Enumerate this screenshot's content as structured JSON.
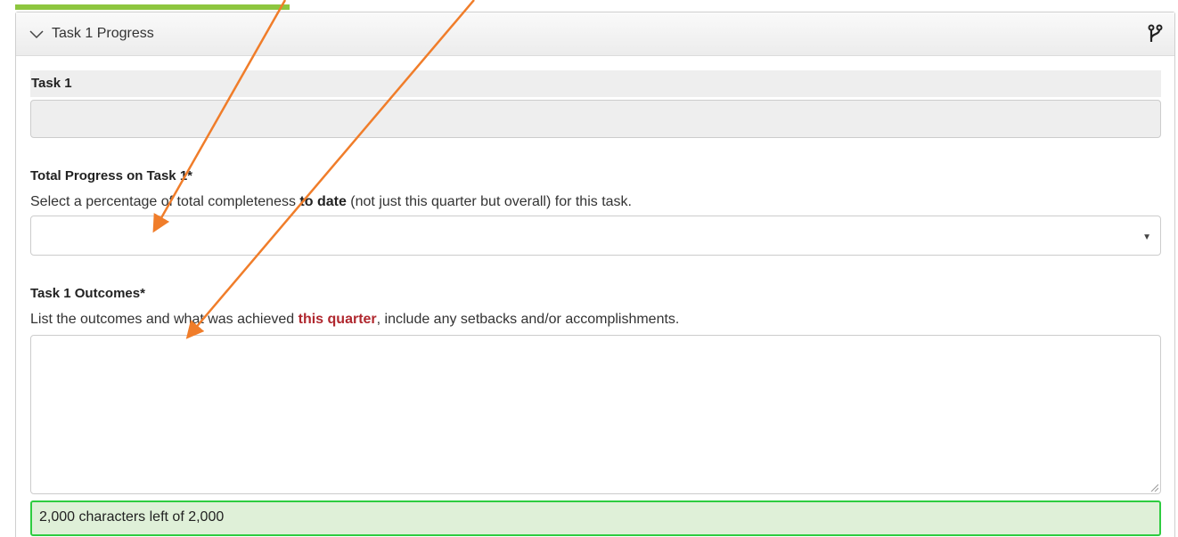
{
  "panel": {
    "title": "Task 1 Progress"
  },
  "task": {
    "section_label": "Task 1"
  },
  "progress": {
    "label": "Total Progress on Task 1*",
    "help_prefix": "Select a percentage of total completeness ",
    "help_bold": "to date",
    "help_suffix": " (not just this quarter but overall) for this task.",
    "selected_value": ""
  },
  "outcomes": {
    "label": "Task 1 Outcomes*",
    "help_prefix": "List the outcomes and what was achieved ",
    "help_highlight": "this quarter",
    "help_suffix": ", include any setbacks and/or accomplishments.",
    "value": "",
    "counter": "2,000 characters left of 2,000"
  },
  "colors": {
    "accent_green_bar": "#8dc63f",
    "annotation_arrow": "#f07d2a",
    "highlight_red": "#b0282f",
    "counter_border": "#2ecc40",
    "counter_bg": "#dff0d8"
  },
  "icons": [
    "chevron-down-icon",
    "branch-icon",
    "dropdown-caret-icon",
    "resize-grip-icon"
  ]
}
